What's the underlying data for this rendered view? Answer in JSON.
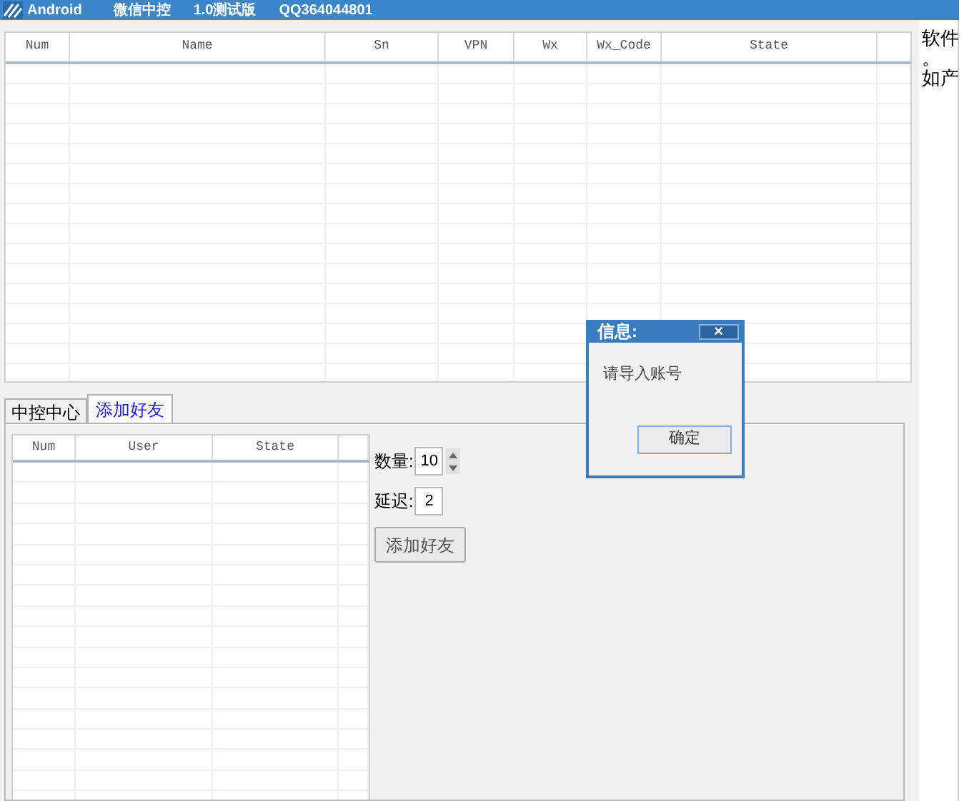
{
  "window": {
    "app_name": "Android",
    "title_parts": [
      "微信中控",
      "1.0测试版",
      "QQ364044801"
    ]
  },
  "main_table": {
    "columns": [
      "Num",
      "Name",
      "Sn",
      "VPN",
      "Wx",
      "Wx_Code",
      "State",
      ""
    ]
  },
  "side_text": [
    "软件",
    "。",
    "如产"
  ],
  "tabs": [
    {
      "label": "中控中心",
      "selected": false
    },
    {
      "label": "添加好友",
      "selected": true
    }
  ],
  "friend_table": {
    "columns": [
      "Num",
      "User",
      "State",
      ""
    ]
  },
  "quantity": {
    "label": "数量:",
    "value": "10"
  },
  "delay": {
    "label": "延迟:",
    "value": "2"
  },
  "add_button": "添加好友",
  "dialog": {
    "title": "信息:",
    "close": "✕",
    "message": "请导入账号",
    "ok": "确定"
  }
}
